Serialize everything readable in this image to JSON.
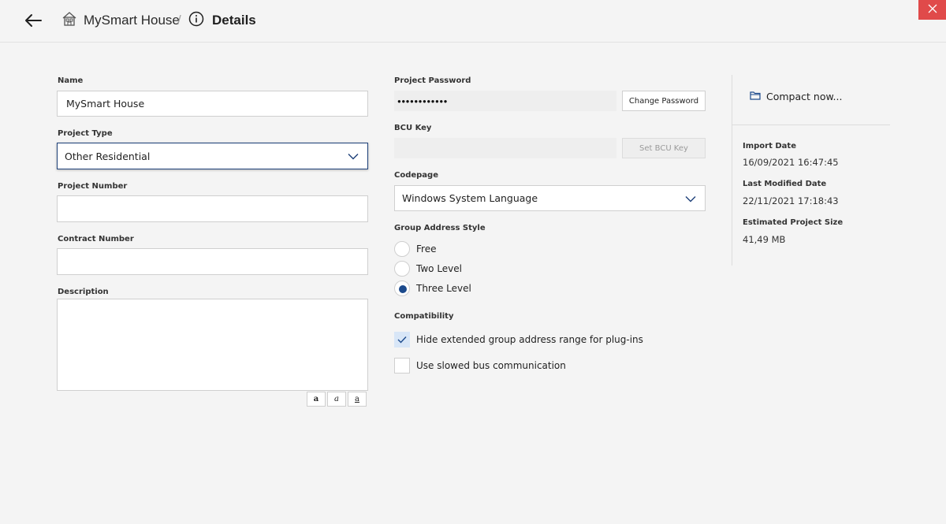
{
  "header": {
    "project_name": "MySmart House",
    "separator": "/",
    "page_title": "Details"
  },
  "form": {
    "name_label": "Name",
    "name_value": "MySmart House",
    "project_type_label": "Project Type",
    "project_type_value": "Other Residential",
    "project_number_label": "Project Number",
    "project_number_value": "",
    "contract_number_label": "Contract Number",
    "contract_number_value": "",
    "description_label": "Description",
    "description_value": "",
    "format_buttons": [
      "a",
      "a",
      "a"
    ]
  },
  "security": {
    "password_label": "Project Password",
    "password_mask": "●●●●●●●●●●●●",
    "change_password": "Change Password",
    "bcu_label": "BCU Key",
    "set_bcu": "Set BCU Key"
  },
  "codepage": {
    "label": "Codepage",
    "value": "Windows System Language"
  },
  "group_address": {
    "label": "Group Address Style",
    "options": [
      "Free",
      "Two Level",
      "Three Level"
    ],
    "selected": "Three Level"
  },
  "compatibility": {
    "label": "Compatibility",
    "hide_extended": "Hide extended group address range for plug-ins",
    "hide_extended_checked": true,
    "slowed_bus": "Use slowed bus communication",
    "slowed_bus_checked": false
  },
  "info": {
    "compact": "Compact now...",
    "import_date_label": "Import Date",
    "import_date": "16/09/2021 16:47:45",
    "modified_label": "Last Modified Date",
    "modified_date": "22/11/2021 17:18:43",
    "size_label": "Estimated Project Size",
    "size_value": "41,49 MB"
  },
  "colors": {
    "accent": "#1c4a8c",
    "close": "#e04a4a",
    "background": "#f4f4f4"
  },
  "icons": [
    "back-arrow-icon",
    "house-icon",
    "info-icon",
    "close-icon",
    "chevron-down-icon",
    "folder-icon",
    "checkmark-icon"
  ]
}
